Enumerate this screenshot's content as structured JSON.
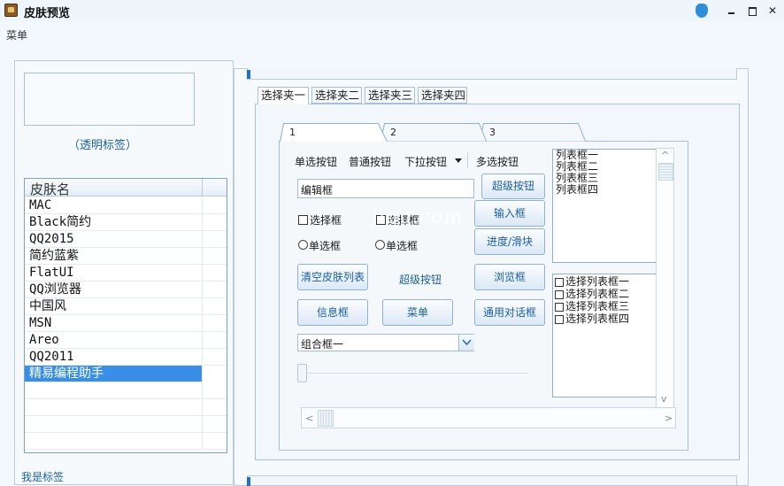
{
  "window": {
    "title": "皮肤预览",
    "menu": "菜单",
    "controls": [
      "minimize",
      "maximize",
      "close"
    ]
  },
  "left": {
    "transparent_label": "（透明标签）",
    "list_header": "皮肤名",
    "skins": [
      "MAC",
      "Black简约",
      "QQ2015",
      "简约蓝紫",
      "FlatUI",
      "QQ浏览器",
      "中国风",
      "MSN",
      "Areo",
      "QQ2011",
      "精易编程助手"
    ],
    "selected_skin": "精易编程助手",
    "bottom_label": "我是标签"
  },
  "outer_tabs": [
    "选择夹一",
    "选择夹二",
    "选择夹三",
    "选择夹四"
  ],
  "inner_tabs": [
    "1",
    "2",
    "3"
  ],
  "controls": {
    "radio_button_label": "单选按钮",
    "normal_button_label": "普通按钮",
    "dropdown_button_label": "下拉按钮",
    "multi_button_label": "多选按钮",
    "edit_box_value": "编辑框",
    "super_button_1": "超级按钮",
    "input_button": "输入框",
    "progress_button": "进度/滑块",
    "browse_button": "浏览框",
    "dialog_button": "通用对话框",
    "clear_skin_button": "清空皮肤列表",
    "super_button_2": "超级按钮",
    "info_button": "信息框",
    "menu_button": "菜单",
    "checkbox_1": "选择框",
    "checkbox_2": "选择框",
    "radio_1": "单选框",
    "radio_2": "单选框",
    "combo_value": "组合框一"
  },
  "list_box": [
    "列表框一",
    "列表框二",
    "列表框三",
    "列表框四"
  ],
  "check_list_box": [
    "选择列表框一",
    "选择列表框二",
    "选择列表框三",
    "选择列表框四"
  ],
  "watermark": "jiqu.com",
  "colors": {
    "accent": "#1d5f9e",
    "selection": "#3a8ee6",
    "border": "#a7bfd7"
  }
}
